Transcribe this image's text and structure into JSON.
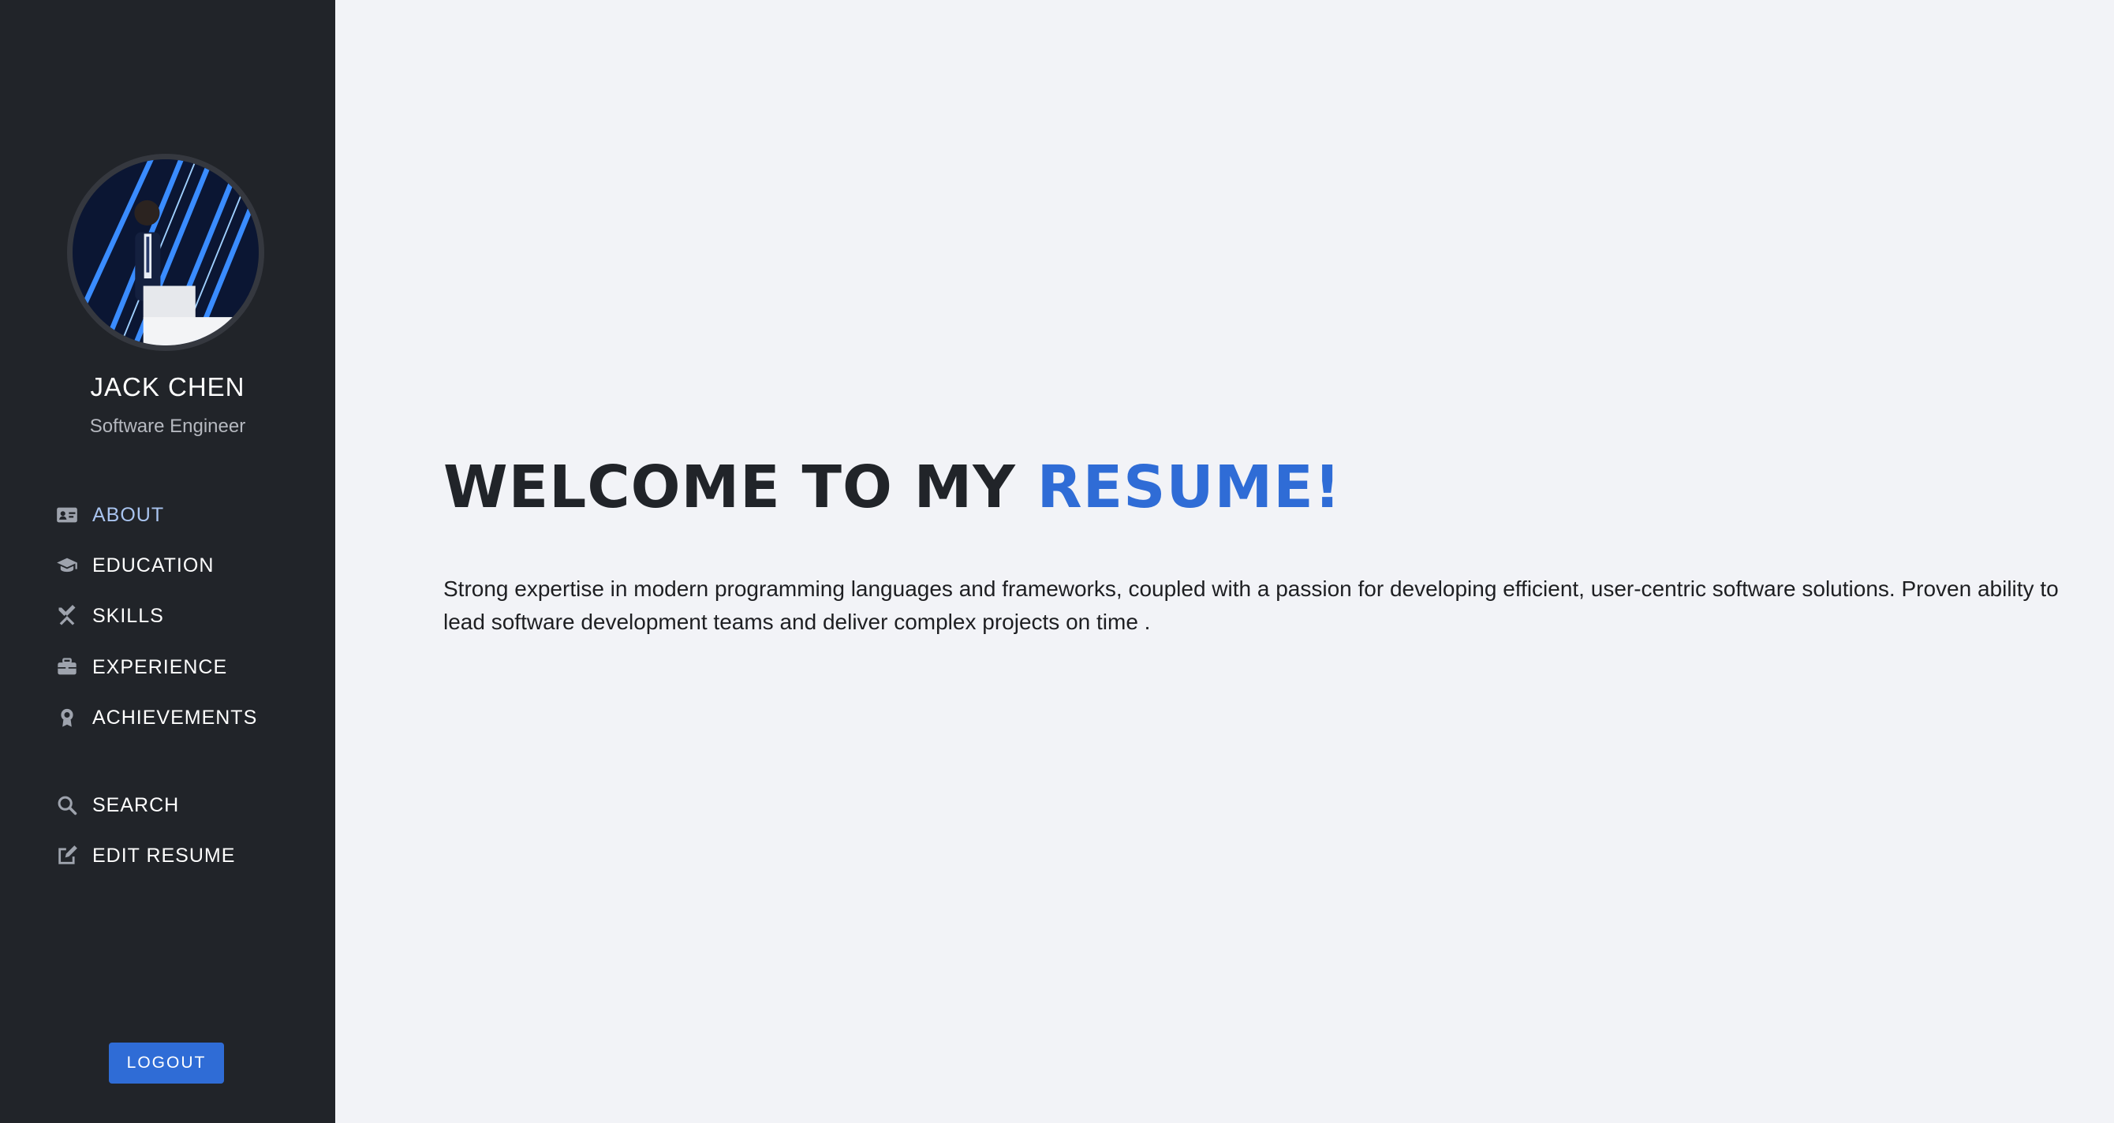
{
  "profile": {
    "name": "JACK CHEN",
    "role": "Software Engineer"
  },
  "nav": {
    "items": [
      {
        "label": "ABOUT",
        "icon": "id-card-icon",
        "active": true
      },
      {
        "label": "EDUCATION",
        "icon": "graduation-cap-icon"
      },
      {
        "label": "SKILLS",
        "icon": "tools-icon"
      },
      {
        "label": "EXPERIENCE",
        "icon": "briefcase-icon"
      },
      {
        "label": "ACHIEVEMENTS",
        "icon": "award-icon"
      },
      {
        "label": "SEARCH",
        "icon": "search-icon"
      },
      {
        "label": "EDIT RESUME",
        "icon": "edit-icon"
      }
    ]
  },
  "logout_label": "LOGOUT",
  "main": {
    "welcome_prefix": "WELCOME TO MY ",
    "welcome_accent": "RESUME!",
    "intro": "Strong expertise in modern programming languages and frameworks, coupled with a passion for developing efficient, user-centric software solutions. Proven ability to lead software development teams and deliver complex projects on time ."
  },
  "colors": {
    "sidebar_bg": "#212429",
    "main_bg": "#f2f3f7",
    "accent": "#2f6cd6",
    "active_nav": "#a9c4ef",
    "heading": "#212429"
  }
}
